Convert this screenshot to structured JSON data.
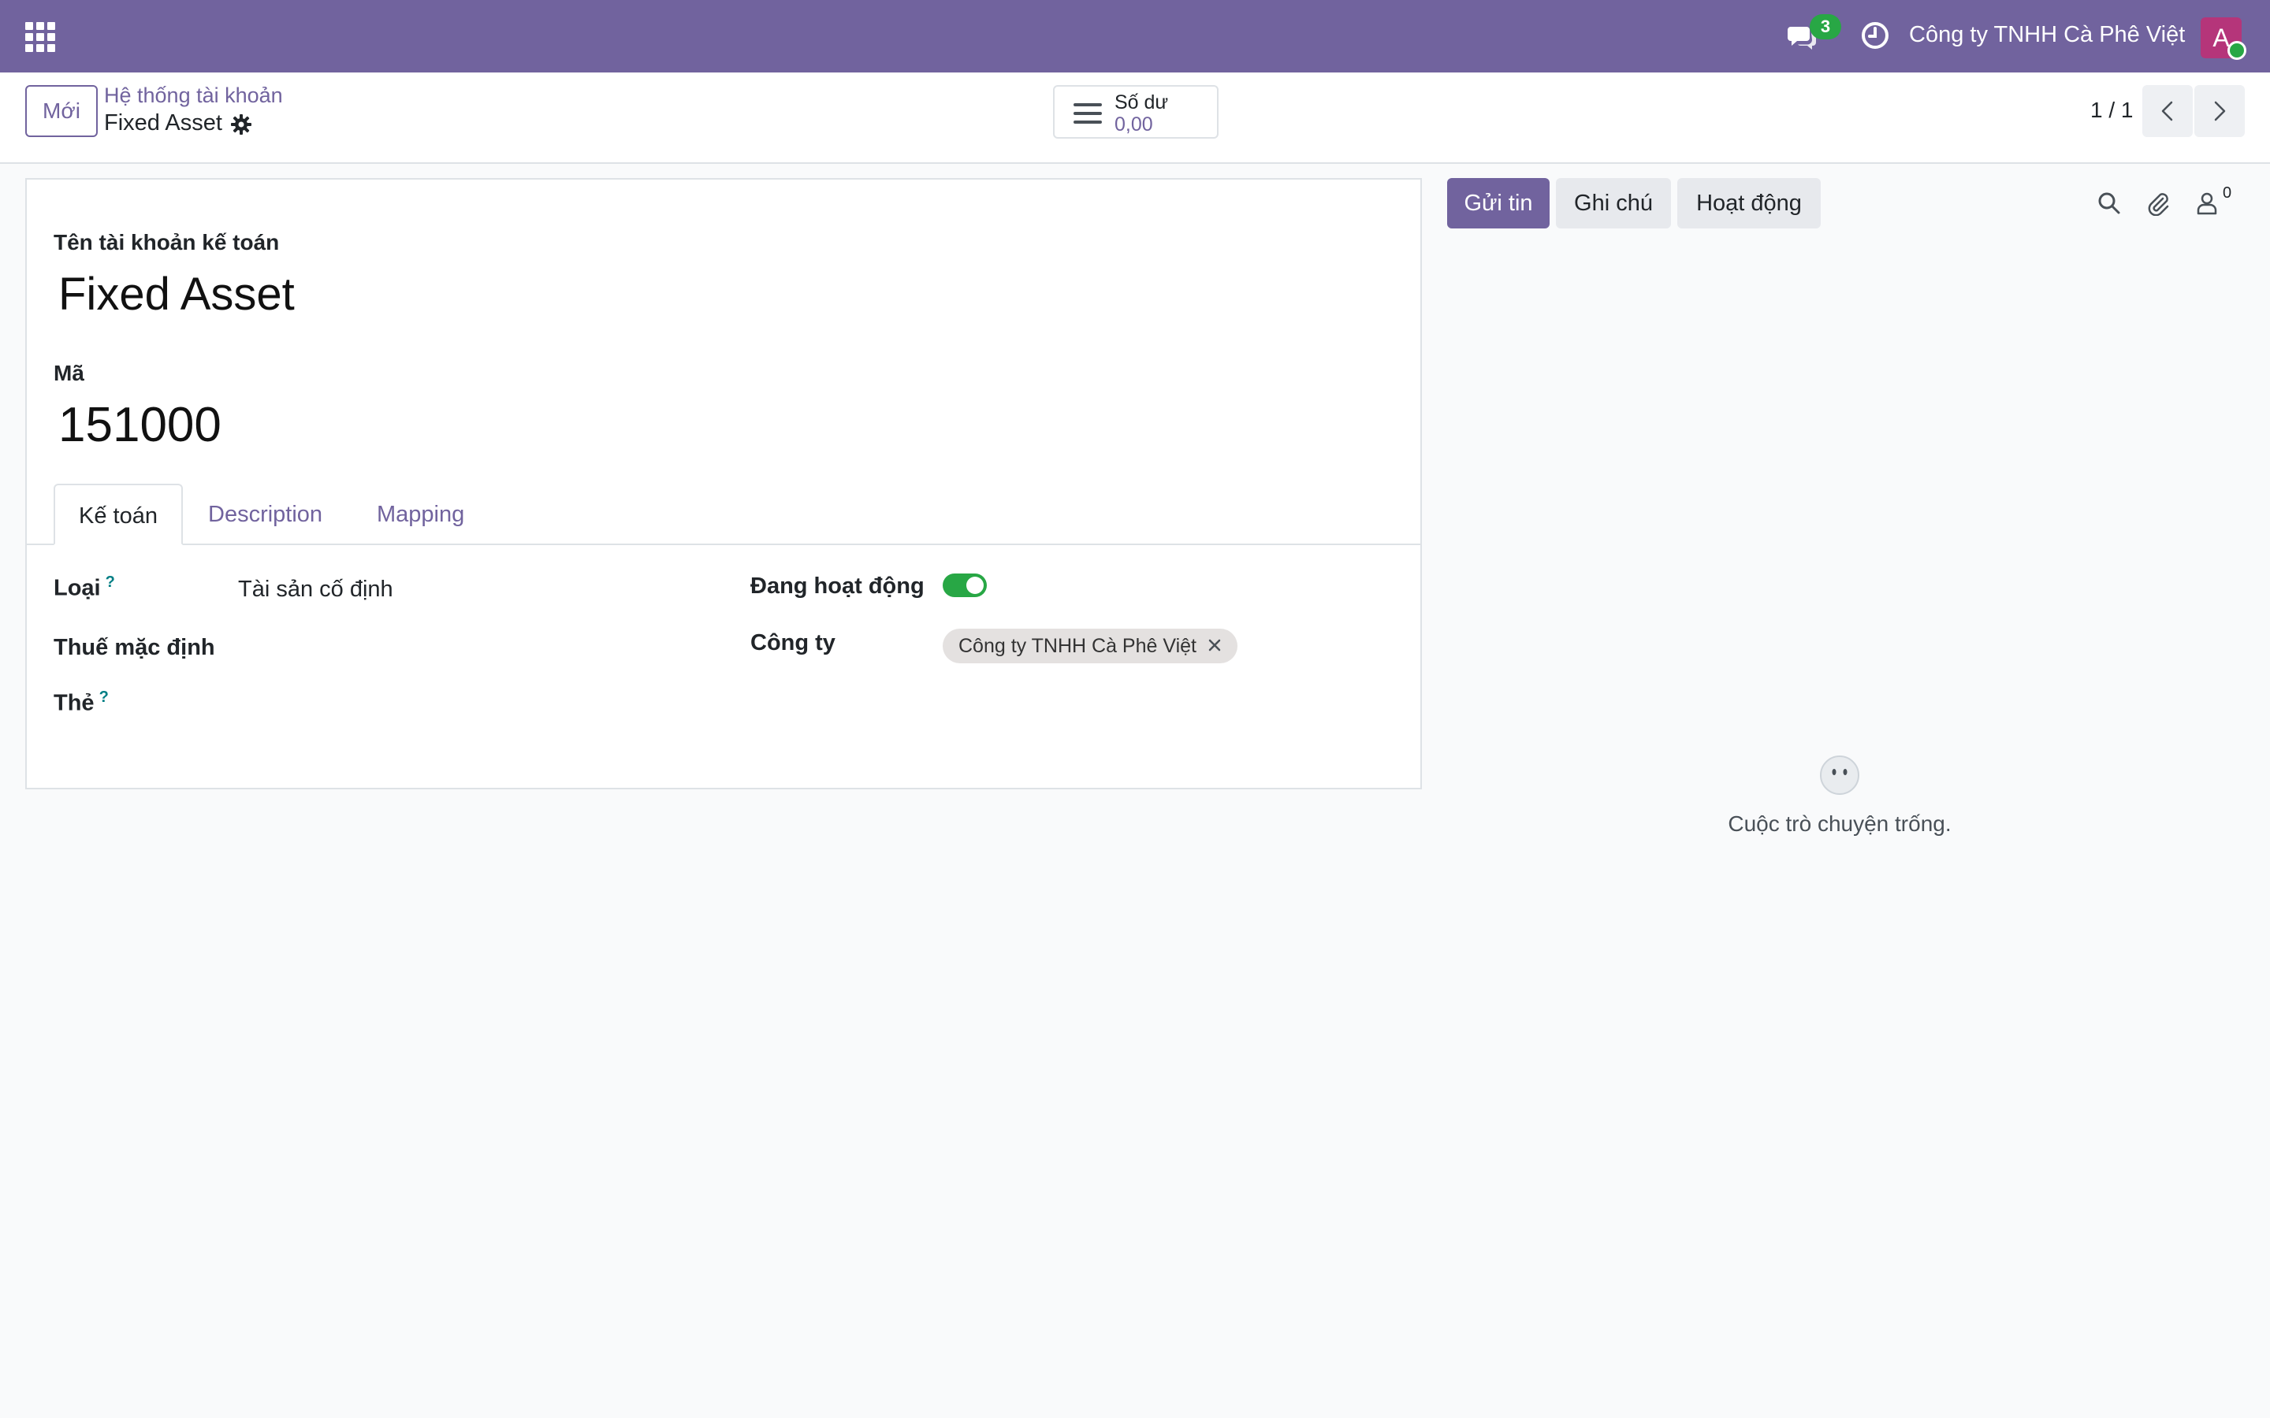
{
  "navbar": {
    "message_count": "3",
    "company": "Công ty TNHH Cà Phê Việt",
    "avatar_letter": "A"
  },
  "control": {
    "new_label": "Mới",
    "breadcrumb_parent": "Hệ thống tài khoản",
    "breadcrumb_current": "Fixed Asset",
    "stat_label": "Số dư",
    "stat_value": "0,00",
    "pager": "1 / 1"
  },
  "form": {
    "name_label": "Tên tài khoản kế toán",
    "name_value": "Fixed Asset",
    "code_label": "Mã",
    "code_value": "151000",
    "tabs": [
      {
        "label": "Kế toán"
      },
      {
        "label": "Description"
      },
      {
        "label": "Mapping"
      }
    ],
    "fields": {
      "type_label": "Loại",
      "type_value": "Tài sản cố định",
      "help_mark": "?",
      "tax_label": "Thuế mặc định",
      "tags_label": "Thẻ",
      "active_label": "Đang hoạt động",
      "active_on": true,
      "company_label": "Công ty",
      "company_tag": "Công ty TNHH Cà Phê Việt"
    }
  },
  "chatter": {
    "send_label": "Gửi tin",
    "note_label": "Ghi chú",
    "activity_label": "Hoạt động",
    "follower_count": "0",
    "empty_text": "Cuộc trò chuyện trống."
  },
  "colors": {
    "brand": "#71639e",
    "success": "#28a745",
    "avatar": "#b5357a"
  }
}
